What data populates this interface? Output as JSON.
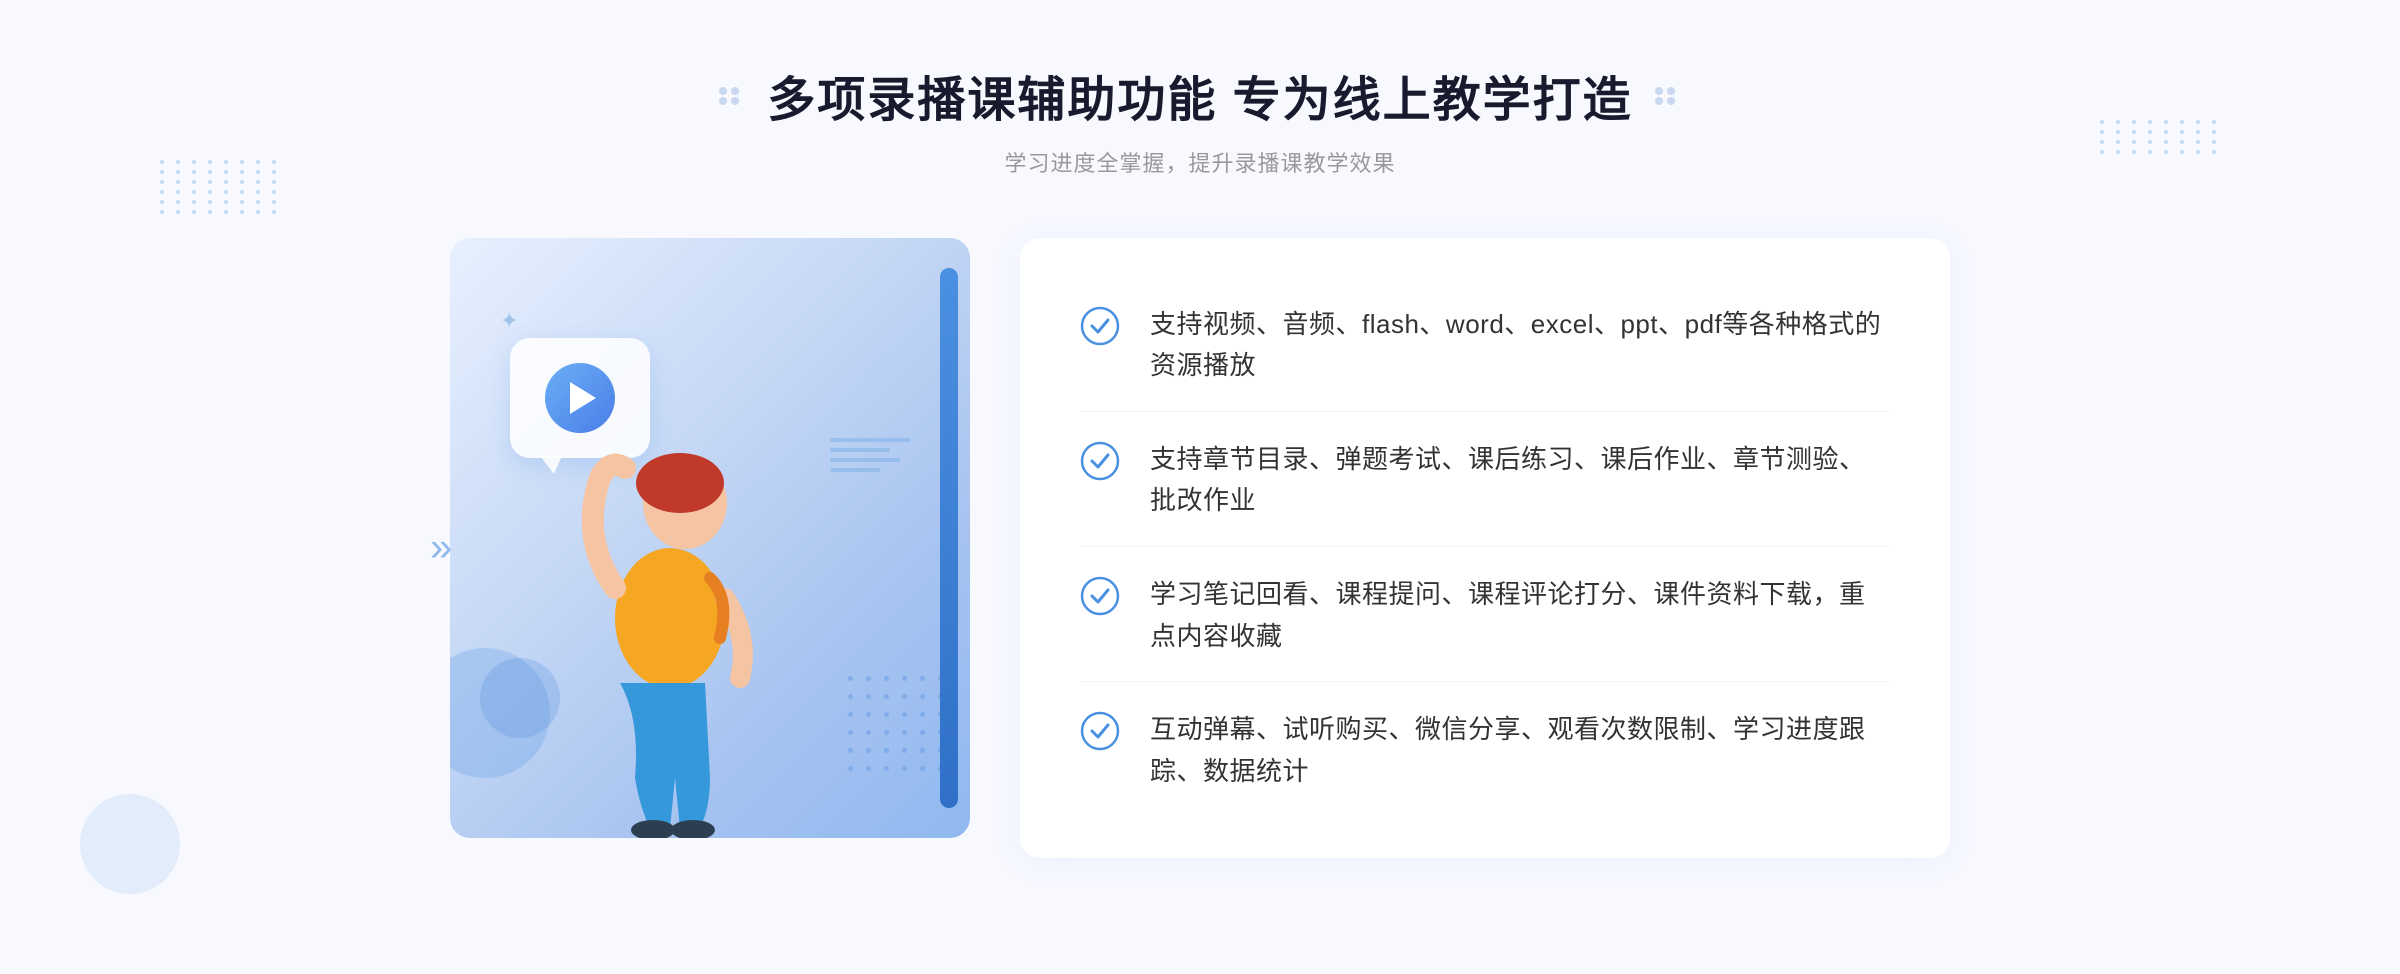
{
  "page": {
    "background": "#f8f9ff"
  },
  "header": {
    "main_title": "多项录播课辅助功能 专为线上教学打造",
    "subtitle": "学习进度全掌握，提升录播课教学效果"
  },
  "features": [
    {
      "id": 1,
      "text": "支持视频、音频、flash、word、excel、ppt、pdf等各种格式的资源播放"
    },
    {
      "id": 2,
      "text": "支持章节目录、弹题考试、课后练习、课后作业、章节测验、批改作业"
    },
    {
      "id": 3,
      "text": "学习笔记回看、课程提问、课程评论打分、课件资料下载，重点内容收藏"
    },
    {
      "id": 4,
      "text": "互动弹幕、试听购买、微信分享、观看次数限制、学习进度跟踪、数据统计"
    }
  ],
  "colors": {
    "accent_blue": "#4a90e2",
    "title_color": "#1a1a2e",
    "text_color": "#333333",
    "subtitle_color": "#999999",
    "check_color": "#4a90e2",
    "bg_gradient_start": "#e8f0fe",
    "bg_gradient_end": "#90b8f0"
  }
}
